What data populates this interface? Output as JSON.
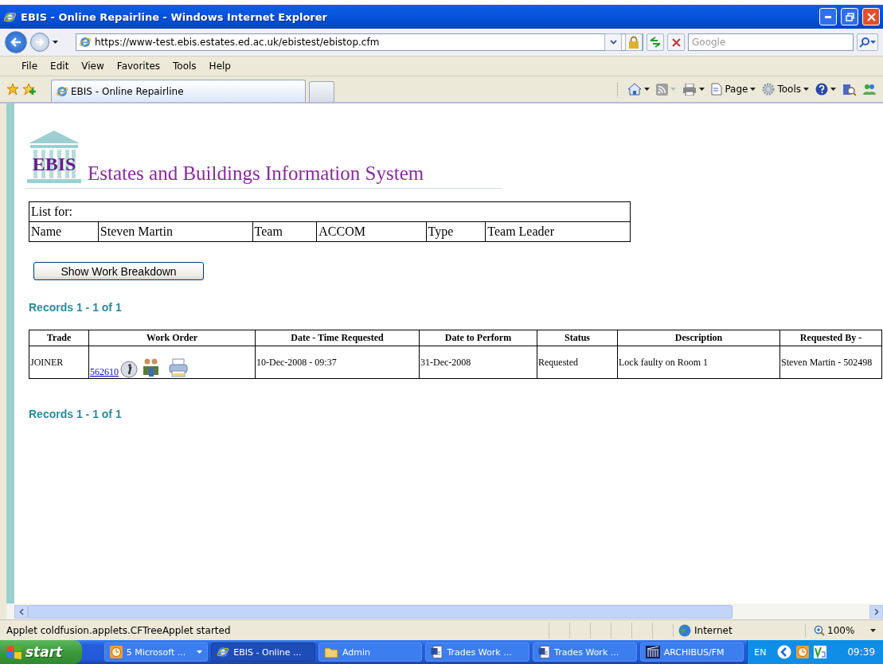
{
  "window": {
    "title": "EBIS - Online Repairline - Windows Internet Explorer"
  },
  "address_bar": {
    "url": "https://www-test.ebis.estates.ed.ac.uk/ebistest/ebistop.cfm",
    "search_placeholder": "Google"
  },
  "menu": [
    "File",
    "Edit",
    "View",
    "Favorites",
    "Tools",
    "Help"
  ],
  "tabs": [
    {
      "label": "EBIS - Online Repairline",
      "selected": true
    }
  ],
  "command_bar": [
    {
      "kind": "home"
    },
    {
      "kind": "feed"
    },
    {
      "kind": "print"
    },
    {
      "kind": "page",
      "label": "Page"
    },
    {
      "kind": "tools",
      "label": "Tools"
    },
    {
      "kind": "help"
    },
    {
      "kind": "research"
    },
    {
      "kind": "messenger"
    }
  ],
  "page": {
    "logo": "EBIS",
    "title": "Estates and Buildings Information System",
    "list_for": {
      "heading": "List for:",
      "cells": [
        "Name",
        "Steven Martin",
        "Team",
        "ACCOM",
        "Type",
        "Team Leader"
      ]
    },
    "button": "Show Work Breakdown",
    "records_top": "Records 1 - 1 of 1",
    "table": {
      "columns": [
        "Trade",
        "Work Order",
        "Date - Time Requested",
        "Date to Perform",
        "Status",
        "Description",
        "Requested By -"
      ],
      "rows": [
        {
          "trade": "JOINER",
          "work_order": "562610",
          "requested": "10-Dec-2008 - 09:37",
          "perform": "31-Dec-2008",
          "status": "Requested",
          "description": "Lock faulty on Room 1",
          "requested_by": "Steven Martin - 502498"
        }
      ]
    },
    "records_bottom": "Records 1 - 1 of 1"
  },
  "status_bar": {
    "text": "Applet coldfusion.applets.CFTreeApplet started",
    "zone": "Internet",
    "zoom": "100%"
  },
  "taskbar": {
    "start": "start",
    "items": [
      {
        "label": "5 Microsoft ...",
        "kind": "group",
        "selected": false
      },
      {
        "label": "EBIS - Online ...",
        "kind": "ie",
        "selected": true
      },
      {
        "label": "Admin",
        "kind": "folder",
        "selected": false
      },
      {
        "label": "Trades Work ...",
        "kind": "word",
        "selected": false
      },
      {
        "label": "Trades Work ...",
        "kind": "word",
        "selected": false
      },
      {
        "label": "ARCHIBUS/FM",
        "kind": "app",
        "selected": false
      }
    ],
    "language": "EN",
    "clock": "09:39"
  }
}
